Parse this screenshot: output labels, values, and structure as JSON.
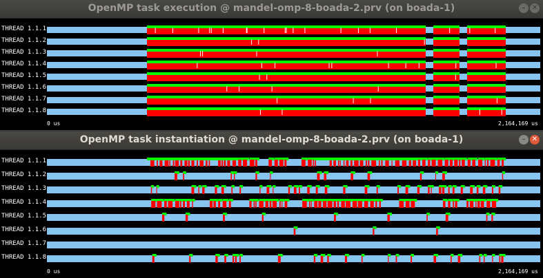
{
  "colors": {
    "idle": "#87c4f0",
    "running": "#ff0000",
    "executing": "#00ff00",
    "background": "#000000",
    "title_active": "#dfdbd2",
    "title_inactive": "#9c9a94"
  },
  "win1": {
    "title": "OpenMP task execution @ mandel-omp-8-boada-2.prv (on boada-1)",
    "min_glyph": "–",
    "close_glyph": "✕",
    "start_time": "0 us",
    "end_time": "2,164,169 us",
    "threads": [
      "THREAD 1.1.1",
      "THREAD 1.1.2",
      "THREAD 1.1.3",
      "THREAD 1.1.4",
      "THREAD 1.1.5",
      "THREAD 1.1.6",
      "THREAD 1.1.7",
      "THREAD 1.1.8"
    ]
  },
  "win2": {
    "title": "OpenMP task instantiation @ mandel-omp-8-boada-2.prv (on boada-1)",
    "min_glyph": "–",
    "close_glyph": "✕",
    "start_time": "0 us",
    "end_time": "2,164,169 us",
    "threads": [
      "THREAD 1.1.1",
      "THREAD 1.1.2",
      "THREAD 1.1.3",
      "THREAD 1.1.4",
      "THREAD 1.1.5",
      "THREAD 1.1.6",
      "THREAD 1.1.7",
      "THREAD 1.1.8"
    ]
  }
}
